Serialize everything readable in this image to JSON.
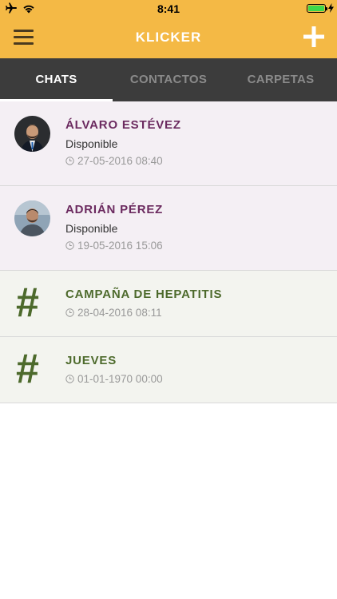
{
  "status_bar": {
    "time": "8:41",
    "icons": [
      "airplane-icon",
      "wifi-icon",
      "battery-icon",
      "charging-bolt-icon"
    ],
    "battery_level": 1.0,
    "battery_color": "#3cd84a"
  },
  "header": {
    "title": "KLICKER",
    "menu_icon": "hamburger-menu-icon",
    "add_icon": "plus-icon",
    "background": "#f4b945"
  },
  "tabs": [
    {
      "label": "CHATS",
      "active": true
    },
    {
      "label": "CONTACTOS",
      "active": false
    },
    {
      "label": "CARPETAS",
      "active": false
    }
  ],
  "chats": [
    {
      "type": "person",
      "name": "ÁLVARO ESTÉVEZ",
      "status": "Disponible",
      "timestamp": "27-05-2016 08:40"
    },
    {
      "type": "person",
      "name": "ADRIÁN PÉREZ",
      "status": "Disponible",
      "timestamp": "19-05-2016 15:06"
    },
    {
      "type": "group",
      "icon": "#",
      "name": "CAMPAÑA DE HEPATITIS",
      "timestamp": "28-04-2016 08:11"
    },
    {
      "type": "group",
      "icon": "#",
      "name": "JUEVES",
      "timestamp": "01-01-1970 00:00"
    }
  ],
  "colors": {
    "accent": "#f4b945",
    "tab_bar": "#3c3c3c",
    "person_name": "#6b2a5f",
    "group_name": "#4d6a2c",
    "person_row_bg": "#f4eff4",
    "group_row_bg": "#f3f4ef"
  }
}
